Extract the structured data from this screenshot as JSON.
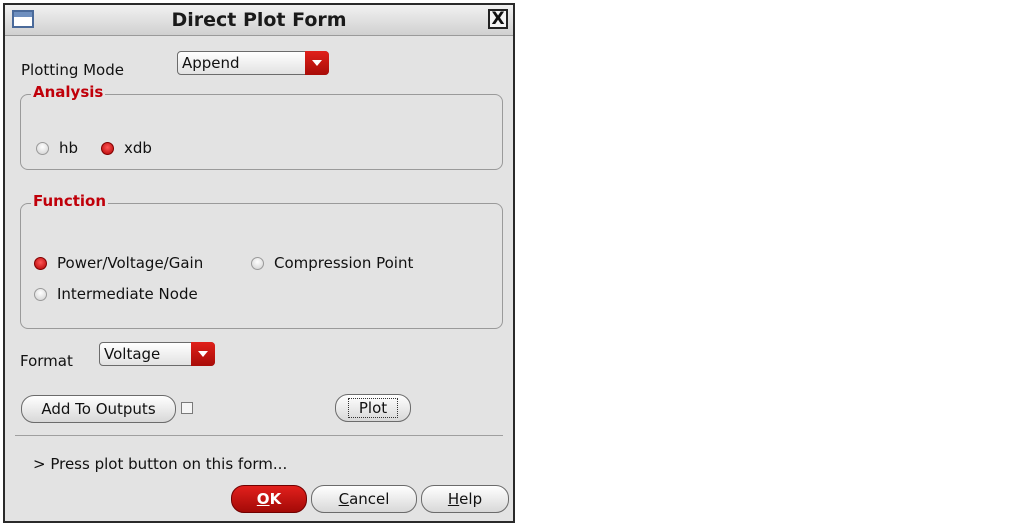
{
  "window": {
    "title": "Direct Plot Form",
    "close_glyph": "X",
    "icon": "window-menu-icon"
  },
  "plotting_mode": {
    "label": "Plotting Mode",
    "value": "Append"
  },
  "analysis": {
    "title": "Analysis",
    "options": [
      {
        "label": "hb",
        "selected": false
      },
      {
        "label": "xdb",
        "selected": true
      }
    ]
  },
  "function": {
    "title": "Function",
    "options": [
      {
        "label": "Power/Voltage/Gain",
        "selected": true
      },
      {
        "label": "Compression Point",
        "selected": false
      },
      {
        "label": "Intermediate Node",
        "selected": false
      }
    ]
  },
  "format": {
    "label": "Format",
    "value": "Voltage"
  },
  "add_to_outputs": {
    "label": "Add To Outputs",
    "checked": false
  },
  "plot_button": {
    "label": "Plot"
  },
  "status": {
    "message": "> Press plot button on this form..."
  },
  "footer": {
    "ok_mnemonic": "O",
    "ok_rest": "K",
    "cancel_mnemonic": "C",
    "cancel_rest": "ancel",
    "help_mnemonic": "H",
    "help_rest": "elp"
  },
  "colors": {
    "accent": "#c0000a",
    "dialog_bg": "#e3e3e3",
    "selected_radio": "#d01010"
  }
}
